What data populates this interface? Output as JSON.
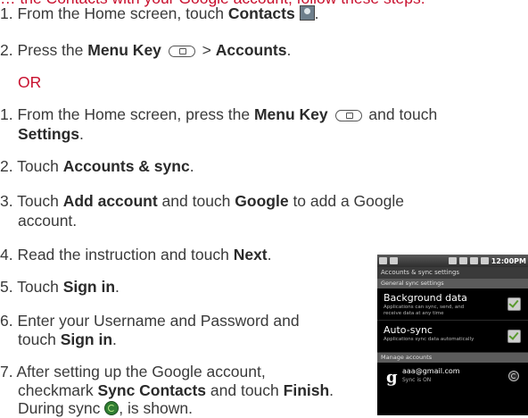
{
  "header_fragment": "… the Contacts with your Google account, follow these steps:",
  "steps_a": [
    {
      "prefix": "1. From the Home screen, touch ",
      "bold": "Contacts",
      "suffix": "."
    },
    {
      "prefix": "2. Press the ",
      "bold": "Menu Key",
      "mid": " > ",
      "bold2": "Accounts",
      "suffix": "."
    }
  ],
  "or_label": "OR",
  "steps_b": {
    "s1_prefix": "1. From the Home screen, press the ",
    "s1_bold": "Menu Key",
    "s1_mid": " and touch",
    "s1_line2_bold": "Settings",
    "s1_line2_suffix": ".",
    "s2_prefix": "2. Touch ",
    "s2_bold": "Accounts & sync",
    "s2_suffix": ".",
    "s3_prefix": "3. Touch ",
    "s3_bold": "Add account",
    "s3_mid": " and touch ",
    "s3_bold2": "Google",
    "s3_suffix": " to add a Google",
    "s3_line2": "account.",
    "s4_prefix": "4. Read the instruction and touch ",
    "s4_bold": "Next",
    "s4_suffix": ".",
    "s5_prefix": "5. Touch ",
    "s5_bold": "Sign in",
    "s5_suffix": ".",
    "s6_line1": "6. Enter your Username and Password and",
    "s6_prefix2": "touch ",
    "s6_bold": "Sign in",
    "s6_suffix": ".",
    "s7_line1": "7. After setting up the Google account,",
    "s7_prefix2": "checkmark ",
    "s7_bold": "Sync Contacts",
    "s7_mid": " and touch ",
    "s7_bold2": "Finish",
    "s7_suffix": ".",
    "s7_line3_prefix": "During sync ",
    "s7_line3_suffix": ", is shown."
  },
  "phone": {
    "status_time": "12:00PM",
    "screen_title": "Accounts & sync settings",
    "section_general": "General sync settings",
    "background_data_title": "Background data",
    "background_data_desc": "Applications can sync, send, and receive data at any time",
    "auto_sync_title": "Auto-sync",
    "auto_sync_desc": "Applications sync data automatically",
    "section_manage": "Manage accounts",
    "account_email": "aaa@gmail.com",
    "account_status": "Sync is ON",
    "background_data_checked": true,
    "auto_sync_checked": true
  },
  "icons": [
    "contacts-icon",
    "menu-key-icon",
    "sync-icon",
    "google-g-icon",
    "checkbox-checked-icon"
  ]
}
